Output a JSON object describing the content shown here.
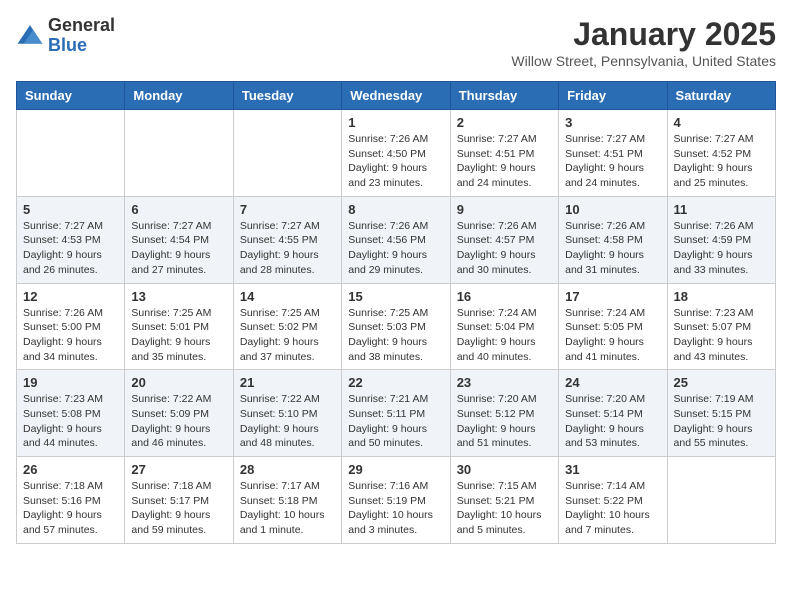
{
  "header": {
    "logo_general": "General",
    "logo_blue": "Blue",
    "month_title": "January 2025",
    "location": "Willow Street, Pennsylvania, United States"
  },
  "days_of_week": [
    "Sunday",
    "Monday",
    "Tuesday",
    "Wednesday",
    "Thursday",
    "Friday",
    "Saturday"
  ],
  "weeks": [
    [
      {
        "day": "",
        "info": ""
      },
      {
        "day": "",
        "info": ""
      },
      {
        "day": "",
        "info": ""
      },
      {
        "day": "1",
        "info": "Sunrise: 7:26 AM\nSunset: 4:50 PM\nDaylight: 9 hours\nand 23 minutes."
      },
      {
        "day": "2",
        "info": "Sunrise: 7:27 AM\nSunset: 4:51 PM\nDaylight: 9 hours\nand 24 minutes."
      },
      {
        "day": "3",
        "info": "Sunrise: 7:27 AM\nSunset: 4:51 PM\nDaylight: 9 hours\nand 24 minutes."
      },
      {
        "day": "4",
        "info": "Sunrise: 7:27 AM\nSunset: 4:52 PM\nDaylight: 9 hours\nand 25 minutes."
      }
    ],
    [
      {
        "day": "5",
        "info": "Sunrise: 7:27 AM\nSunset: 4:53 PM\nDaylight: 9 hours\nand 26 minutes."
      },
      {
        "day": "6",
        "info": "Sunrise: 7:27 AM\nSunset: 4:54 PM\nDaylight: 9 hours\nand 27 minutes."
      },
      {
        "day": "7",
        "info": "Sunrise: 7:27 AM\nSunset: 4:55 PM\nDaylight: 9 hours\nand 28 minutes."
      },
      {
        "day": "8",
        "info": "Sunrise: 7:26 AM\nSunset: 4:56 PM\nDaylight: 9 hours\nand 29 minutes."
      },
      {
        "day": "9",
        "info": "Sunrise: 7:26 AM\nSunset: 4:57 PM\nDaylight: 9 hours\nand 30 minutes."
      },
      {
        "day": "10",
        "info": "Sunrise: 7:26 AM\nSunset: 4:58 PM\nDaylight: 9 hours\nand 31 minutes."
      },
      {
        "day": "11",
        "info": "Sunrise: 7:26 AM\nSunset: 4:59 PM\nDaylight: 9 hours\nand 33 minutes."
      }
    ],
    [
      {
        "day": "12",
        "info": "Sunrise: 7:26 AM\nSunset: 5:00 PM\nDaylight: 9 hours\nand 34 minutes."
      },
      {
        "day": "13",
        "info": "Sunrise: 7:25 AM\nSunset: 5:01 PM\nDaylight: 9 hours\nand 35 minutes."
      },
      {
        "day": "14",
        "info": "Sunrise: 7:25 AM\nSunset: 5:02 PM\nDaylight: 9 hours\nand 37 minutes."
      },
      {
        "day": "15",
        "info": "Sunrise: 7:25 AM\nSunset: 5:03 PM\nDaylight: 9 hours\nand 38 minutes."
      },
      {
        "day": "16",
        "info": "Sunrise: 7:24 AM\nSunset: 5:04 PM\nDaylight: 9 hours\nand 40 minutes."
      },
      {
        "day": "17",
        "info": "Sunrise: 7:24 AM\nSunset: 5:05 PM\nDaylight: 9 hours\nand 41 minutes."
      },
      {
        "day": "18",
        "info": "Sunrise: 7:23 AM\nSunset: 5:07 PM\nDaylight: 9 hours\nand 43 minutes."
      }
    ],
    [
      {
        "day": "19",
        "info": "Sunrise: 7:23 AM\nSunset: 5:08 PM\nDaylight: 9 hours\nand 44 minutes."
      },
      {
        "day": "20",
        "info": "Sunrise: 7:22 AM\nSunset: 5:09 PM\nDaylight: 9 hours\nand 46 minutes."
      },
      {
        "day": "21",
        "info": "Sunrise: 7:22 AM\nSunset: 5:10 PM\nDaylight: 9 hours\nand 48 minutes."
      },
      {
        "day": "22",
        "info": "Sunrise: 7:21 AM\nSunset: 5:11 PM\nDaylight: 9 hours\nand 50 minutes."
      },
      {
        "day": "23",
        "info": "Sunrise: 7:20 AM\nSunset: 5:12 PM\nDaylight: 9 hours\nand 51 minutes."
      },
      {
        "day": "24",
        "info": "Sunrise: 7:20 AM\nSunset: 5:14 PM\nDaylight: 9 hours\nand 53 minutes."
      },
      {
        "day": "25",
        "info": "Sunrise: 7:19 AM\nSunset: 5:15 PM\nDaylight: 9 hours\nand 55 minutes."
      }
    ],
    [
      {
        "day": "26",
        "info": "Sunrise: 7:18 AM\nSunset: 5:16 PM\nDaylight: 9 hours\nand 57 minutes."
      },
      {
        "day": "27",
        "info": "Sunrise: 7:18 AM\nSunset: 5:17 PM\nDaylight: 9 hours\nand 59 minutes."
      },
      {
        "day": "28",
        "info": "Sunrise: 7:17 AM\nSunset: 5:18 PM\nDaylight: 10 hours\nand 1 minute."
      },
      {
        "day": "29",
        "info": "Sunrise: 7:16 AM\nSunset: 5:19 PM\nDaylight: 10 hours\nand 3 minutes."
      },
      {
        "day": "30",
        "info": "Sunrise: 7:15 AM\nSunset: 5:21 PM\nDaylight: 10 hours\nand 5 minutes."
      },
      {
        "day": "31",
        "info": "Sunrise: 7:14 AM\nSunset: 5:22 PM\nDaylight: 10 hours\nand 7 minutes."
      },
      {
        "day": "",
        "info": ""
      }
    ]
  ]
}
